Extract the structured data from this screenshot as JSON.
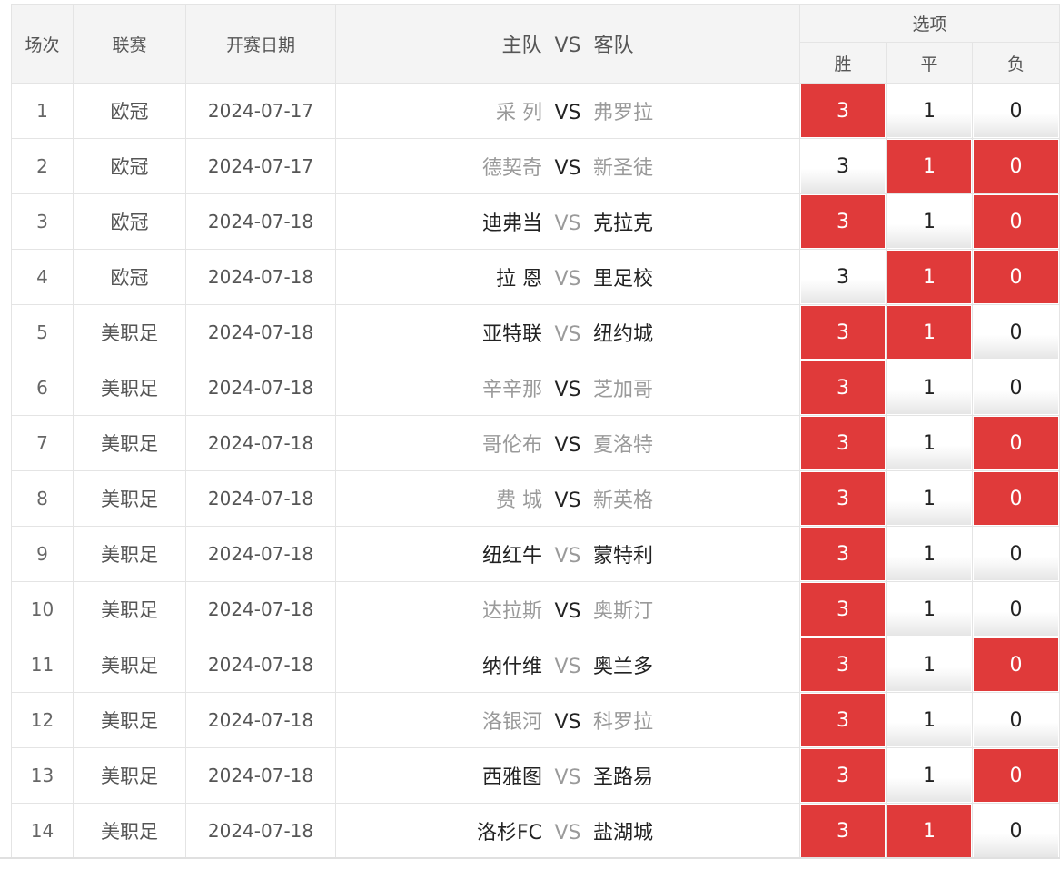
{
  "header": {
    "col_index": "场次",
    "col_league": "联赛",
    "col_date": "开赛日期",
    "col_home": "主队",
    "col_vs": "VS",
    "col_away": "客队",
    "col_options": "选项",
    "opt_win": "胜",
    "opt_draw": "平",
    "opt_lose": "负"
  },
  "colors": {
    "selected": "#e03a3a",
    "header_bg": "#f4f4f4",
    "border": "#e4e4e4"
  },
  "rows": [
    {
      "no": "1",
      "league": "欧冠",
      "date": "2024-07-17",
      "home": "采 列",
      "vs": "VS",
      "away": "弗罗拉",
      "win": "3",
      "draw": "1",
      "lose": "0",
      "win_sel": true,
      "draw_sel": false,
      "lose_sel": false,
      "home_dark": false,
      "away_dark": false
    },
    {
      "no": "2",
      "league": "欧冠",
      "date": "2024-07-17",
      "home": "德契奇",
      "vs": "VS",
      "away": "新圣徒",
      "win": "3",
      "draw": "1",
      "lose": "0",
      "win_sel": false,
      "draw_sel": true,
      "lose_sel": true,
      "home_dark": false,
      "away_dark": false
    },
    {
      "no": "3",
      "league": "欧冠",
      "date": "2024-07-18",
      "home": "迪弗当",
      "vs": "VS",
      "away": "克拉克",
      "win": "3",
      "draw": "1",
      "lose": "0",
      "win_sel": true,
      "draw_sel": false,
      "lose_sel": true,
      "home_dark": true,
      "away_dark": true
    },
    {
      "no": "4",
      "league": "欧冠",
      "date": "2024-07-18",
      "home": "拉 恩",
      "vs": "VS",
      "away": "里足校",
      "win": "3",
      "draw": "1",
      "lose": "0",
      "win_sel": false,
      "draw_sel": true,
      "lose_sel": true,
      "home_dark": true,
      "away_dark": true
    },
    {
      "no": "5",
      "league": "美职足",
      "date": "2024-07-18",
      "home": "亚特联",
      "vs": "VS",
      "away": "纽约城",
      "win": "3",
      "draw": "1",
      "lose": "0",
      "win_sel": true,
      "draw_sel": true,
      "lose_sel": false,
      "home_dark": true,
      "away_dark": true
    },
    {
      "no": "6",
      "league": "美职足",
      "date": "2024-07-18",
      "home": "辛辛那",
      "vs": "VS",
      "away": "芝加哥",
      "win": "3",
      "draw": "1",
      "lose": "0",
      "win_sel": true,
      "draw_sel": false,
      "lose_sel": false,
      "home_dark": false,
      "away_dark": false
    },
    {
      "no": "7",
      "league": "美职足",
      "date": "2024-07-18",
      "home": "哥伦布",
      "vs": "VS",
      "away": "夏洛特",
      "win": "3",
      "draw": "1",
      "lose": "0",
      "win_sel": true,
      "draw_sel": false,
      "lose_sel": true,
      "home_dark": false,
      "away_dark": false
    },
    {
      "no": "8",
      "league": "美职足",
      "date": "2024-07-18",
      "home": "费 城",
      "vs": "VS",
      "away": "新英格",
      "win": "3",
      "draw": "1",
      "lose": "0",
      "win_sel": true,
      "draw_sel": false,
      "lose_sel": true,
      "home_dark": false,
      "away_dark": false
    },
    {
      "no": "9",
      "league": "美职足",
      "date": "2024-07-18",
      "home": "纽红牛",
      "vs": "VS",
      "away": "蒙特利",
      "win": "3",
      "draw": "1",
      "lose": "0",
      "win_sel": true,
      "draw_sel": false,
      "lose_sel": false,
      "home_dark": true,
      "away_dark": true
    },
    {
      "no": "10",
      "league": "美职足",
      "date": "2024-07-18",
      "home": "达拉斯",
      "vs": "VS",
      "away": "奥斯汀",
      "win": "3",
      "draw": "1",
      "lose": "0",
      "win_sel": true,
      "draw_sel": false,
      "lose_sel": false,
      "home_dark": false,
      "away_dark": false
    },
    {
      "no": "11",
      "league": "美职足",
      "date": "2024-07-18",
      "home": "纳什维",
      "vs": "VS",
      "away": "奥兰多",
      "win": "3",
      "draw": "1",
      "lose": "0",
      "win_sel": true,
      "draw_sel": false,
      "lose_sel": true,
      "home_dark": true,
      "away_dark": true
    },
    {
      "no": "12",
      "league": "美职足",
      "date": "2024-07-18",
      "home": "洛银河",
      "vs": "VS",
      "away": "科罗拉",
      "win": "3",
      "draw": "1",
      "lose": "0",
      "win_sel": true,
      "draw_sel": false,
      "lose_sel": false,
      "home_dark": false,
      "away_dark": false
    },
    {
      "no": "13",
      "league": "美职足",
      "date": "2024-07-18",
      "home": "西雅图",
      "vs": "VS",
      "away": "圣路易",
      "win": "3",
      "draw": "1",
      "lose": "0",
      "win_sel": true,
      "draw_sel": false,
      "lose_sel": true,
      "home_dark": true,
      "away_dark": true
    },
    {
      "no": "14",
      "league": "美职足",
      "date": "2024-07-18",
      "home": "洛杉FC",
      "vs": "VS",
      "away": "盐湖城",
      "win": "3",
      "draw": "1",
      "lose": "0",
      "win_sel": true,
      "draw_sel": true,
      "lose_sel": false,
      "home_dark": true,
      "away_dark": true
    }
  ]
}
